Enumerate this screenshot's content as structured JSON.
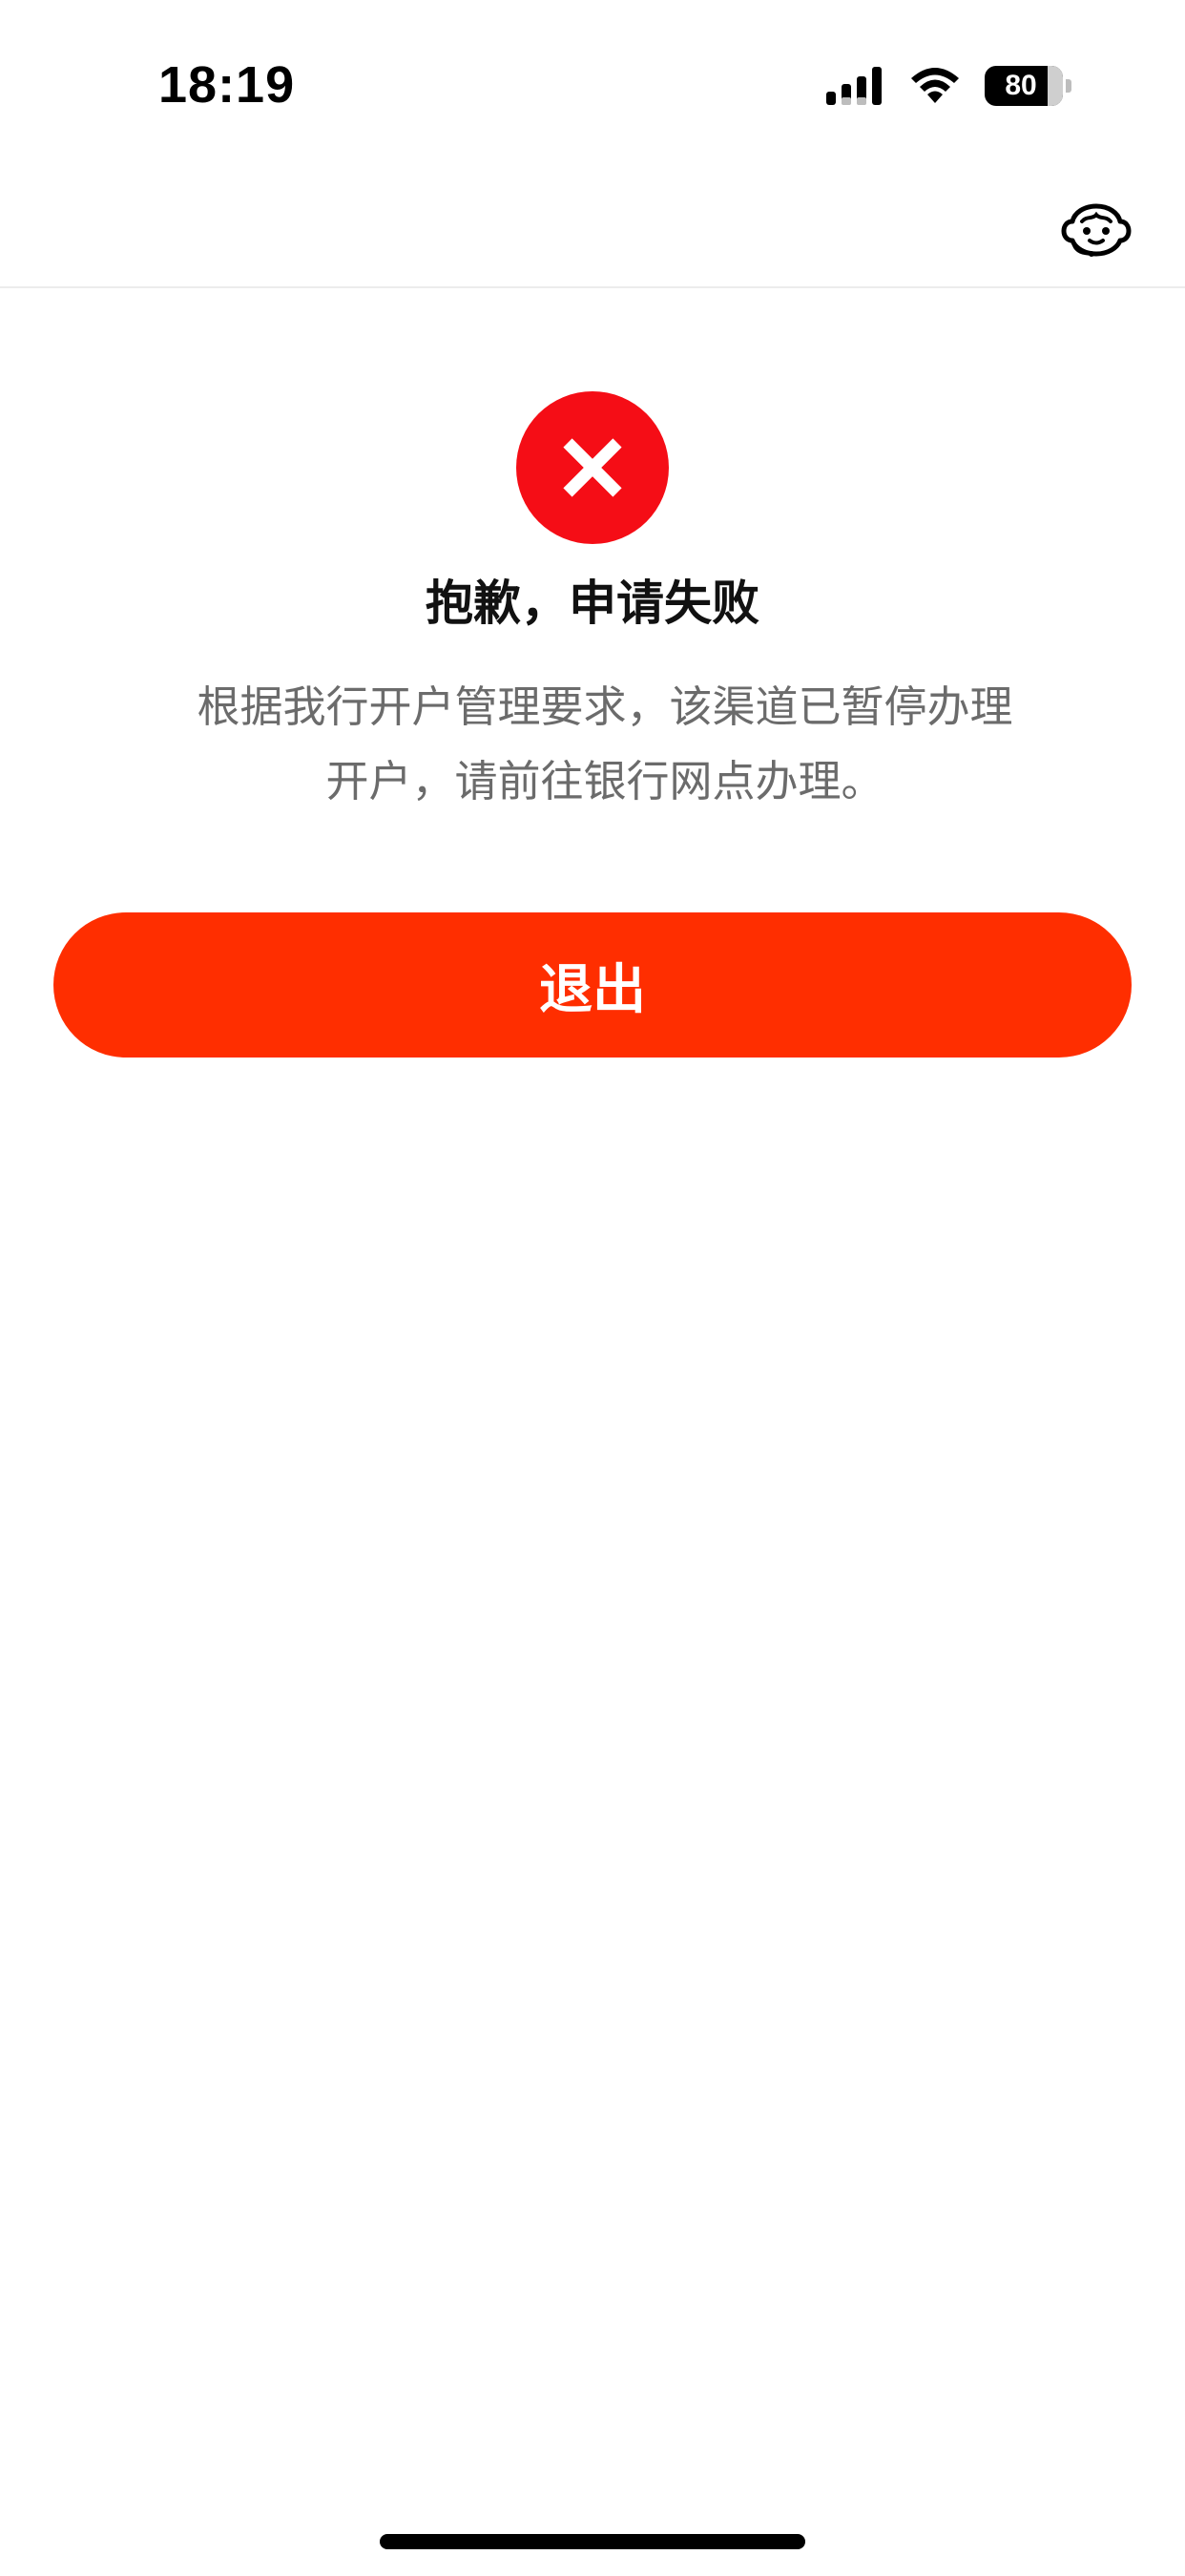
{
  "status_bar": {
    "time": "18:19",
    "battery_percent": "80",
    "battery_level": 80
  },
  "nav": {
    "service_icon": "customer-service-icon"
  },
  "result": {
    "icon": "close-icon",
    "title": "抱歉，申请失败",
    "description": "根据我行开户管理要求，该渠道已暂停办理开户，请前往银行网点办理。"
  },
  "actions": {
    "exit_label": "退出"
  },
  "colors": {
    "error_red": "#f50d16",
    "primary_button": "#ff2e00",
    "description_text": "#6b6b6b"
  }
}
